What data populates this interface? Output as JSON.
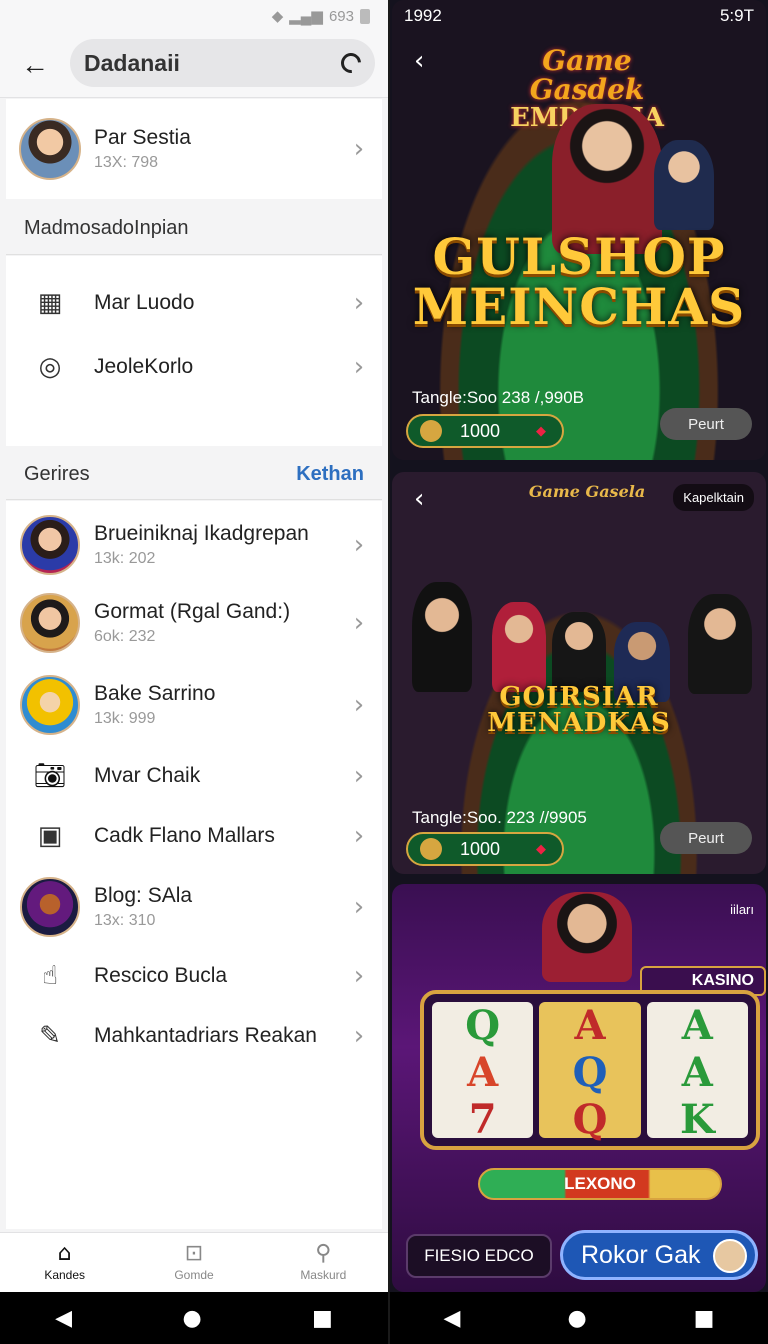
{
  "left": {
    "status": {
      "text": "693"
    },
    "header": {
      "search_value": "Dadanaii"
    },
    "profile": {
      "name": "Par Sestia",
      "sub": "13X: 798"
    },
    "section1": {
      "title": "MadmosadoInpian",
      "items": [
        {
          "label": "Mar Luodo",
          "icon": "building-icon"
        },
        {
          "label": "JeoleKorlo",
          "icon": "target-icon"
        }
      ]
    },
    "section2": {
      "title": "Gerires",
      "link": "Kethan",
      "items": [
        {
          "label": "Brueiniknaj Ikadgrepan",
          "sub": "13k: 202"
        },
        {
          "label": "Gormat (Rgal Gand:)",
          "sub": "6ok: 232"
        },
        {
          "label": "Bake Sarrino",
          "sub": "13k: 999"
        },
        {
          "label": "Mvar Chaik",
          "icon": "camera-icon"
        },
        {
          "label": "Cadk Flano Mallars",
          "icon": "photo-frame-icon"
        },
        {
          "label": "Blog: SAla",
          "sub": "13x: 310"
        },
        {
          "label": "Rescico Bucla",
          "icon": "hand-icon"
        },
        {
          "label": "Mahkantadriars Reakan",
          "icon": "edit-icon"
        }
      ]
    },
    "tabs": [
      {
        "label": "Kandes",
        "icon": "home-icon"
      },
      {
        "label": "Gomde",
        "icon": "gamepad-icon"
      },
      {
        "label": "Maskurd",
        "icon": "search-icon"
      }
    ]
  },
  "right": {
    "status": {
      "left": "1992",
      "time": "5:9T"
    },
    "banner1": {
      "logo_line1": "Game Gasdek",
      "logo_line2": "EMDMRIA",
      "title_line1": "GULSHOP",
      "title_line2": "MEINCHAS",
      "tangle": "Tangle:Soo 238 /,990B",
      "chip_value": "1000",
      "button": "Peurt"
    },
    "banner2": {
      "logo": "Game Gasela",
      "badge": "Kapelktain",
      "title_line1": "GOIRSIAR",
      "title_line2": "MENADKAS",
      "tangle": "Tangle:Soo. 223 //9905",
      "chip_value": "1000",
      "button": "Peurt"
    },
    "banner3": {
      "kasino": "KASINO",
      "corner": "iiları",
      "reels": [
        [
          "Q",
          "A",
          "7"
        ],
        [
          "A",
          "Q",
          "Q"
        ],
        [
          "A",
          "A",
          "K"
        ]
      ],
      "bar_label": "LEXONO",
      "button_a": "FIESIO EDCO",
      "button_b": "Rokor Gak"
    }
  }
}
